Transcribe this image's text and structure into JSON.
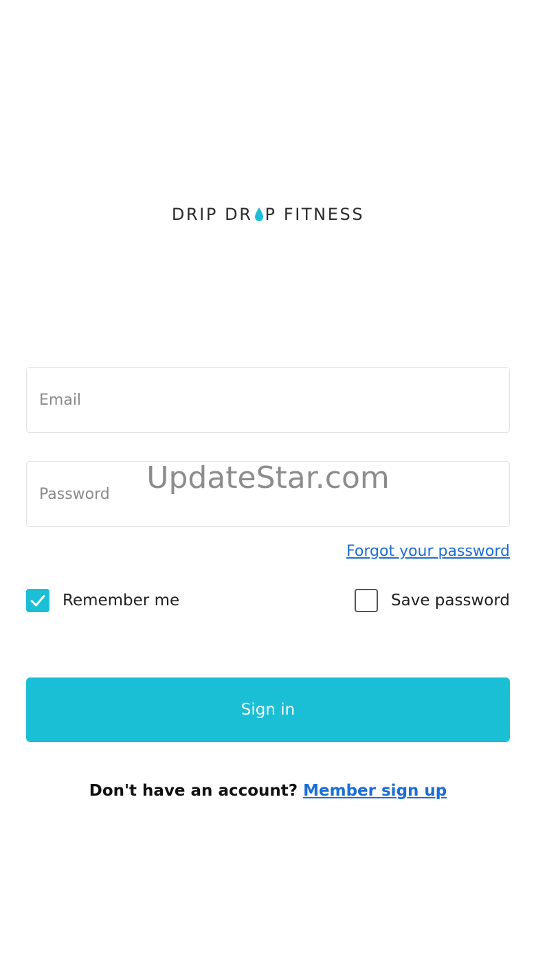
{
  "brand": {
    "part1": "DRIP DR",
    "part2": "P FITNESS",
    "drop_icon": "water-drop-icon",
    "drop_color": "#1bbfd5"
  },
  "form": {
    "email_placeholder": "Email",
    "password_placeholder": "Password",
    "forgot_password": "Forgot your password",
    "remember_me": {
      "label": "Remember me",
      "checked": true
    },
    "save_password": {
      "label": "Save password",
      "checked": false
    },
    "sign_in": "Sign in"
  },
  "signup": {
    "prompt": "Don't have an account? ",
    "link": "Member sign up"
  },
  "watermark": "UpdateStar.com",
  "colors": {
    "accent": "#1bbfd5",
    "link": "#1a6ed8"
  }
}
